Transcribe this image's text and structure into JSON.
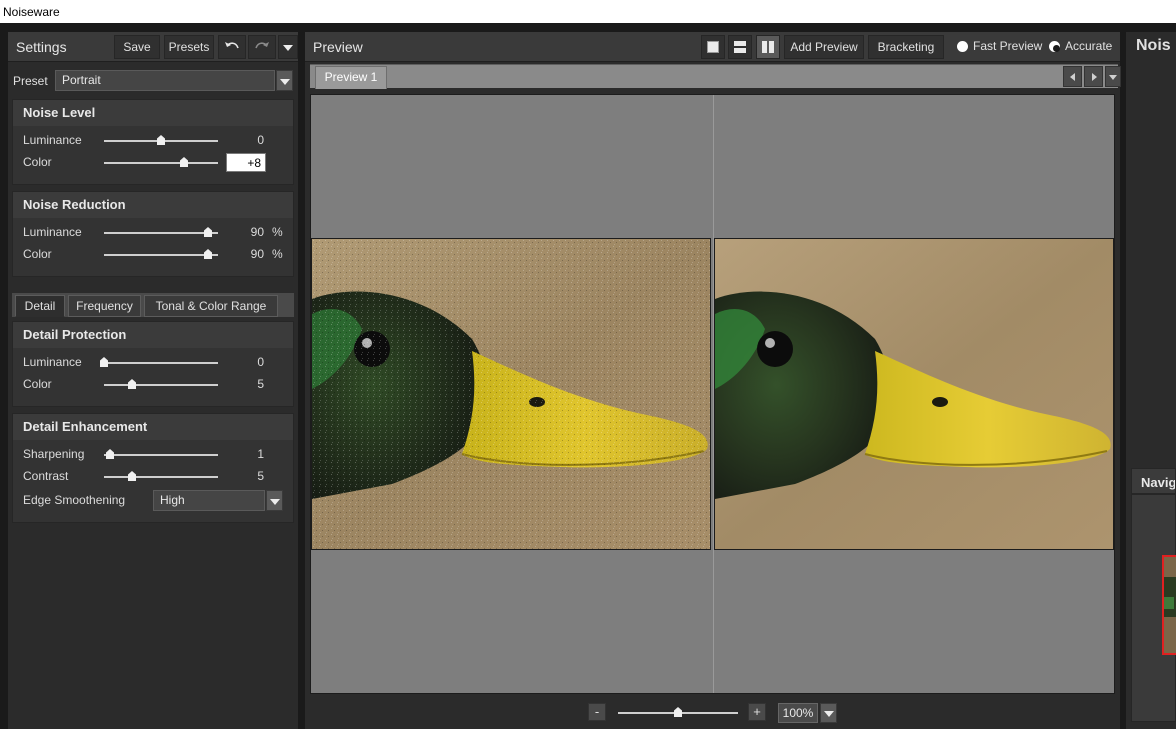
{
  "window": {
    "title": "Noiseware"
  },
  "settings": {
    "title": "Settings",
    "save_label": "Save",
    "presets_label": "Presets",
    "preset_label": "Preset",
    "preset_value": "Portrait",
    "noise_level": {
      "title": "Noise Level",
      "luminance": {
        "label": "Luminance",
        "value": "0"
      },
      "color": {
        "label": "Color",
        "value": "+8"
      }
    },
    "noise_reduction": {
      "title": "Noise Reduction",
      "luminance": {
        "label": "Luminance",
        "value": "90",
        "unit": "%"
      },
      "color": {
        "label": "Color",
        "value": "90",
        "unit": "%"
      }
    },
    "tabs": [
      "Detail",
      "Frequency",
      "Tonal & Color Range"
    ],
    "detail_protection": {
      "title": "Detail Protection",
      "luminance": {
        "label": "Luminance",
        "value": "0"
      },
      "color": {
        "label": "Color",
        "value": "5"
      }
    },
    "detail_enhancement": {
      "title": "Detail Enhancement",
      "sharpening": {
        "label": "Sharpening",
        "value": "1"
      },
      "contrast": {
        "label": "Contrast",
        "value": "5"
      },
      "edge_smoothening": {
        "label": "Edge Smoothening",
        "value": "High"
      }
    }
  },
  "preview": {
    "title": "Preview",
    "add_preview_label": "Add Preview",
    "bracketing_label": "Bracketing",
    "fast_preview_label": "Fast Preview",
    "accurate_label": "Accurate",
    "selected_mode": "Accurate",
    "tab_label": "Preview 1",
    "zoom_minus": "-",
    "zoom_plus": "+",
    "zoom_value": "100%"
  },
  "right_panel": {
    "title": "Nois",
    "navigator_title": "Navig"
  },
  "colors": {
    "panel_bg": "#2b2b2b",
    "header_bg": "#3a3a3a",
    "canvas_bg": "#7e7e7e",
    "navigator_frame": "#e02020"
  },
  "icons": [
    "undo-icon",
    "redo-icon",
    "chevron-down-icon",
    "single-view-icon",
    "split-horizontal-icon",
    "split-vertical-icon",
    "scroll-left-icon",
    "scroll-right-icon"
  ]
}
